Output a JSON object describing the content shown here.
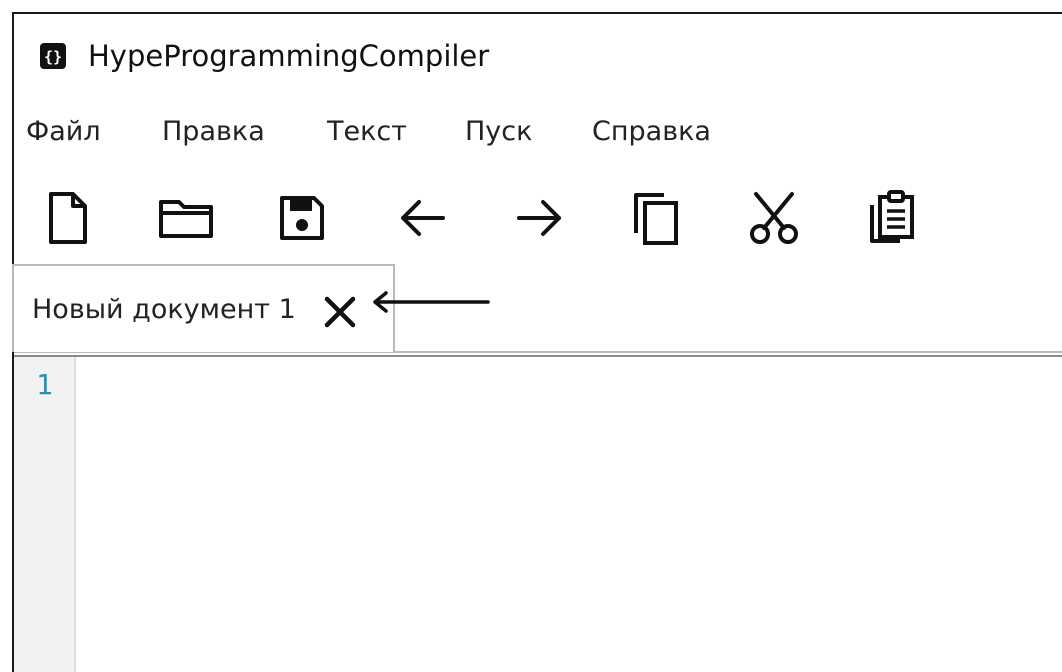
{
  "window": {
    "title": "HypeProgrammingCompiler"
  },
  "menu": {
    "items": [
      {
        "id": "file",
        "label": "Файл"
      },
      {
        "id": "edit",
        "label": "Правка"
      },
      {
        "id": "text",
        "label": "Текст"
      },
      {
        "id": "run",
        "label": "Пуск"
      },
      {
        "id": "help",
        "label": "Справка"
      }
    ]
  },
  "toolbar": {
    "icons": [
      "new-file-icon",
      "open-folder-icon",
      "save-icon",
      "undo-arrow-icon",
      "redo-arrow-icon",
      "copy-icon",
      "cut-icon",
      "paste-icon"
    ]
  },
  "tabs": [
    {
      "label": "Новый документ 1",
      "active": true
    }
  ],
  "editor": {
    "line_numbers": [
      "1"
    ],
    "content": "",
    "line_number_color": "#2b91af"
  }
}
